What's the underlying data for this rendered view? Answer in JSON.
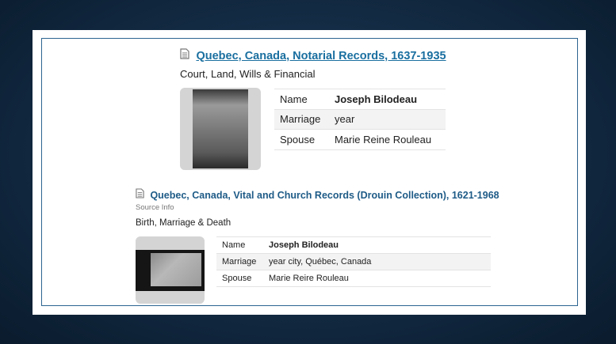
{
  "record1": {
    "title": "Quebec, Canada, Notarial Records, 1637-1935",
    "category": "Court, Land, Wills & Financial",
    "fields": [
      {
        "label": "Name",
        "value": "Joseph Bilodeau"
      },
      {
        "label": "Marriage",
        "value": "year"
      },
      {
        "label": "Spouse",
        "value": "Marie Reine Rouleau"
      }
    ]
  },
  "record2": {
    "title": "Quebec, Canada, Vital and Church Records (Drouin Collection), 1621-1968",
    "source_link": "Source Info",
    "category": "Birth, Marriage & Death",
    "fields": [
      {
        "label": "Name",
        "value": "Joseph Bilodeau"
      },
      {
        "label": "Marriage",
        "value": "year city, Québec, Canada"
      },
      {
        "label": "Spouse",
        "value": "Marie Reire Rouleau"
      }
    ]
  },
  "icons": {
    "record_icon": "document-icon"
  },
  "colors": {
    "link": "#1a6fa0",
    "frame_border": "#2d6590",
    "background": "#122a42"
  }
}
